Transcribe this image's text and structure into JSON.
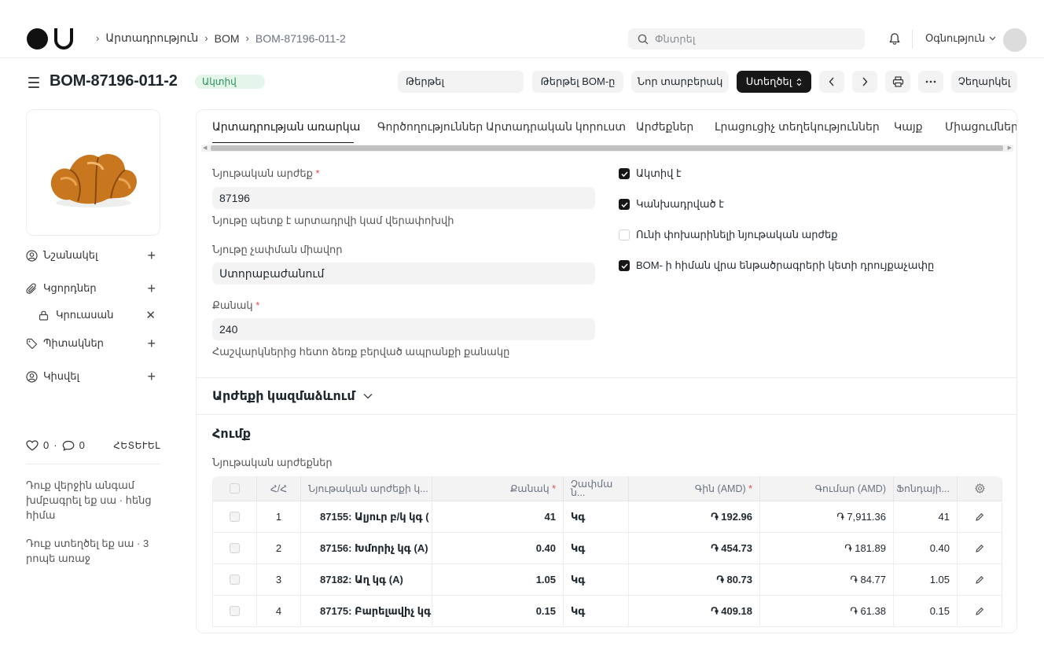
{
  "navbar": {
    "breadcrumb": [
      "Արտադրություն",
      "BOM",
      "BOM-87196-011-2"
    ],
    "search_placeholder": "Փնտրել",
    "help_label": "Օգնություն"
  },
  "page": {
    "title": "BOM-87196-011-2",
    "status": "Ակտիվ",
    "filter_placeholder": "Թերթել",
    "buttons": {
      "browse_bom": "Թերթել BOM-ը",
      "new_version": "Նոր տարբերակ",
      "create": "Ստեղծել",
      "cancel": "Չեղարկել"
    }
  },
  "sidebar": {
    "image_alt": "croissant",
    "assign": "Նշանակել",
    "attachments": "Կցորդներ",
    "attachment_file": "Կրուասան",
    "tags": "Պիտակներ",
    "share": "Կիսվել",
    "likes_count": "0",
    "comments_count": "0",
    "follow": "ՀԵՏԵՒԵԼ",
    "activity": [
      "Դուք վերջին անգամ խմբագրել եք սա · հենց հիմա",
      "Դուք ստեղծել եք սա · 3 րոպե առաջ"
    ]
  },
  "tabs": [
    "Արտադրության առարկա",
    "Գործողություններ",
    "Արտադրական կորուստ",
    "Արժեքներ",
    "Լրացուցիչ տեղեկություններ",
    "Կայք",
    "Միացումներ"
  ],
  "form": {
    "item_label": "Նյութական արժեք",
    "item_value": "87196",
    "item_desc": "Նյութը պետք է արտադրվի կամ վերափոխվի",
    "uom_label": "Նյութը չափման միավոր",
    "uom_value": "Ստորաբաժանում",
    "qty_label": "Քանակ",
    "qty_value": "240",
    "qty_desc": "Հաշվարկներից հետո ձեռք բերված ապրանքի քանակը",
    "is_active": "Ակտիվ է",
    "is_default": "Կանխադրված է",
    "allow_alternative": "Ունի փոխարինելի նյութական արժեք",
    "rate_of_subassembly": "BOM- ի հիման վրա ենթածրագրերի կետի դրույքաչափը"
  },
  "sections": {
    "costing": "Արժեքի կազմաձևում",
    "raw_materials": "Հումք",
    "items_label": "Նյութական արժեքներ"
  },
  "table": {
    "headers": [
      "Հ/Հ",
      "Նյութական արժեքի կ...",
      "Քանակ",
      "Չափմա ն...",
      "Գին (AMD)",
      "Գումար (AMD)",
      "Ֆոնդայի..."
    ],
    "rows": [
      {
        "idx": "1",
        "item": "87155: Ալյուր բ/կ կգ (",
        "qty": "41",
        "uom": "Կգ",
        "rate": "֏ 192.96",
        "amount": "֏ 7,911.36",
        "stock": "41"
      },
      {
        "idx": "2",
        "item": "87156: Խմորիչ կգ (A)",
        "qty": "0.40",
        "uom": "Կգ",
        "rate": "֏ 454.73",
        "amount": "֏ 181.89",
        "stock": "0.40"
      },
      {
        "idx": "3",
        "item": "87182: Աղ կգ (A)",
        "qty": "1.05",
        "uom": "Կգ",
        "rate": "֏ 80.73",
        "amount": "֏ 84.77",
        "stock": "1.05"
      },
      {
        "idx": "4",
        "item": "87175: Բարելավիչ կգ",
        "qty": "0.15",
        "uom": "Կգ",
        "rate": "֏ 409.18",
        "amount": "֏ 61.38",
        "stock": "0.15"
      }
    ]
  },
  "colors": {
    "accent_dark": "#171717",
    "status_green_bg": "#e4f5e9",
    "status_green_text": "#278f5e",
    "required": "#e24c4c"
  }
}
